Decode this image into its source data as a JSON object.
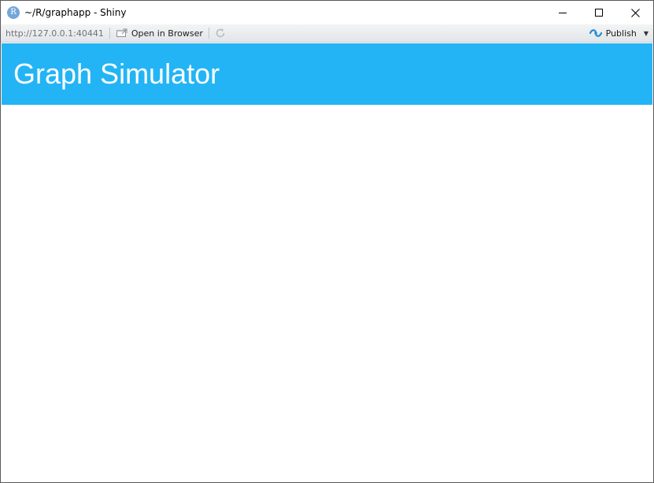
{
  "window": {
    "title": "~/R/graphapp - Shiny",
    "app_icon_letter": "R"
  },
  "toolbar": {
    "url": "http://127.0.0.1:40441",
    "open_in_browser_label": "Open in Browser",
    "publish_label": "Publish"
  },
  "app": {
    "title": "Graph Simulator",
    "header_color": "#23b4f5"
  },
  "icons": {
    "app": "r-logo-icon",
    "minimize": "minimize-icon",
    "maximize": "maximize-icon",
    "close": "close-icon",
    "open_in_browser": "open-in-browser-icon",
    "refresh": "refresh-icon",
    "publish": "publish-icon",
    "publish_menu": "chevron-down-icon"
  }
}
